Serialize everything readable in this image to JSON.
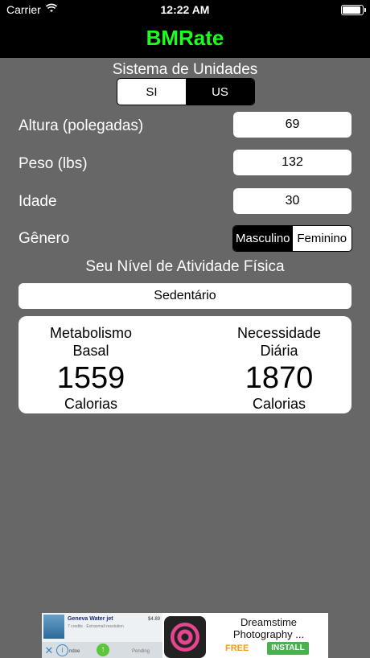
{
  "status_bar": {
    "carrier": "Carrier",
    "time": "12:22 AM",
    "battery_level": 1.0
  },
  "nav": {
    "title": "BMRate",
    "title_color": "#1cff1c"
  },
  "unit_system": {
    "label": "Sistema de Unidades",
    "options": [
      "SI",
      "US"
    ],
    "selected": "US"
  },
  "fields": {
    "height": {
      "label": "Altura (polegadas)",
      "value": "69"
    },
    "weight": {
      "label": "Peso (lbs)",
      "value": "132"
    },
    "age": {
      "label": "Idade",
      "value": "30"
    }
  },
  "gender": {
    "label": "Gênero",
    "options": [
      "Masculino",
      "Feminino"
    ],
    "selected": "Masculino"
  },
  "activity": {
    "label": "Seu Nível de Atividade Física",
    "value": "Sedentário"
  },
  "results": {
    "basal": {
      "label_line1": "Metabolismo",
      "label_line2": "Basal",
      "value": "1559",
      "unit": "Calorias"
    },
    "daily": {
      "label_line1": "Necessidade",
      "label_line2": "Diária",
      "value": "1870",
      "unit": "Calorias"
    }
  },
  "ad": {
    "app_name": "Geneva Water jet",
    "app_sub": "7 credits · Extrasmall resolution",
    "price": "$4.89",
    "store_text": "ndoe",
    "pending_text": "Pending",
    "title": "Dreamstime Photography ...",
    "free_label": "FREE",
    "install_label": "INSTALL"
  }
}
